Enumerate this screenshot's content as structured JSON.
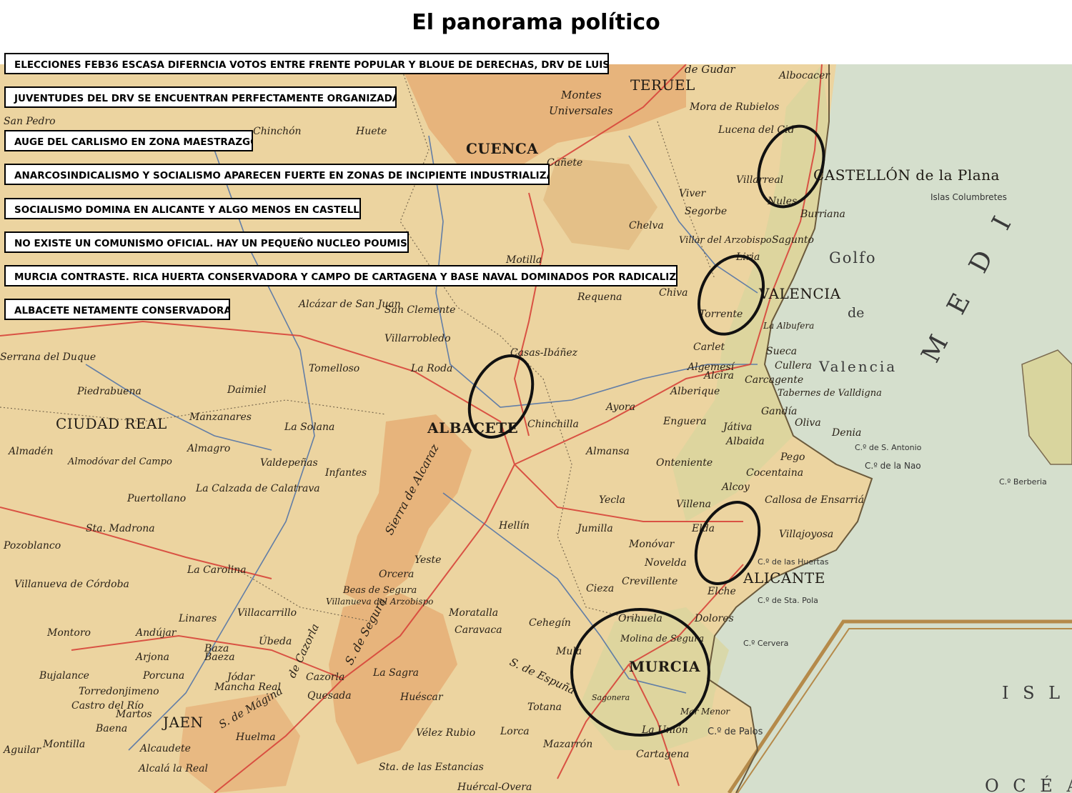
{
  "title": "El panorama político",
  "notes": [
    "ELECCIONES FEB36 ESCASA DIFERNCIA VOTOS  ENTRE FRENTE POPULAR Y BLOUE DE DERECHAS, DRV  DE LUIS LUCIA",
    "JUVENTUDES DEL DRV SE ENCUENTRAN PERFECTAMENTE ORGANIZADAS",
    "AUGE DEL CARLISMO EN ZONA MAESTRAZGO",
    "ANARCOSINDICALISMO Y SOCIALISMO APARECEN FUERTE EN ZONAS DE INCIPIENTE INDUSTRIALIZACION",
    "SOCIALISMO DOMINA EN ALICANTE Y ALGO MENOS EN CASTELLÓN",
    "NO EXISTE UN COMUNISMO OFICIAL. HAY UN PEQUEÑO NUCLEO POUMISTA",
    "MURCIA CONTRASTE. RICA HUERTA CONSERVADORA Y CAMPO DE CARTAGENA Y BASE NAVAL DOMINADOS POR RADICALIZACION",
    "ALBACETE NETAMENTE CONSERVADORA"
  ],
  "map": {
    "cities": {
      "teruel": "TERUEL",
      "cuenca": "CUENCA",
      "castellon": "CASTELLÓN de la Plana",
      "valencia": "VALENCIA",
      "albacete": "ALBACETE",
      "ciudad_real": "CIUDAD REAL",
      "alicante": "ALICANTE",
      "murcia": "MURCIA",
      "jaen": "JAEN"
    },
    "towns": [
      "de Gudar",
      "Albocacer",
      "Montes",
      "Universales",
      "Mora de Rubielos",
      "Lucena del Cid",
      "San Pedro",
      "Chinchón",
      "Huete",
      "Cañete",
      "Villarreal",
      "Nules",
      "Burriana",
      "Viver",
      "Segorbe",
      "Chelva",
      "Villar del Arzobispo",
      "Liria",
      "Sagunto",
      "Motilla",
      "Requena",
      "Chiva",
      "Torrente",
      "La Albufera",
      "Alcázar de San Juan",
      "San Clemente",
      "Villarrobledo",
      "Casas-Ibáñez",
      "La Roda",
      "Tomelloso",
      "Daimiel",
      "Piedrabuena",
      "Manzanares",
      "La Solana",
      "Almagro",
      "Valdepeñas",
      "Infantes",
      "La Calzada de Calatrava",
      "Almodóvar del Campo",
      "Puertollano",
      "Almadén",
      "Chinchilla",
      "Almansa",
      "Ayora",
      "Carlet",
      "Algemesí",
      "Alcira",
      "Alberique",
      "Sueca",
      "Cullera",
      "Carcagente",
      "Tabernes de Valldigna",
      "Gandía",
      "Oliva",
      "Játiva",
      "Albaida",
      "Enguera",
      "Denia",
      "Pego",
      "Cocentaina",
      "Onteniente",
      "Alcoy",
      "Callosa de Ensarriá",
      "Villajoyosa",
      "Yecla",
      "Jumilla",
      "Villena",
      "Elda",
      "Monóvar",
      "Novelda",
      "Crevillente",
      "Elche",
      "Hellín",
      "Cieza",
      "Orihuela",
      "Dolores",
      "Molina de Segura",
      "Sagonera",
      "Mar Menor",
      "La Unión",
      "Cartagena",
      "Mazarrón",
      "Lorca",
      "Totana",
      "Cehegín",
      "Caravaca",
      "Moratalla",
      "Mula",
      "Yeste",
      "Orcera",
      "Beas de Segura",
      "Villanueva del Arzobispo",
      "Villacarrillo",
      "Úbeda",
      "La Carolina",
      "Linares",
      "Andújar",
      "Montoro",
      "Villanueva de Córdoba",
      "Pozoblanco",
      "Sta. Madrona",
      "Arjona",
      "Baeza",
      "Porcuna",
      "Torredonjimeno",
      "Bujalance",
      "Castro del Río",
      "Martos",
      "Baena",
      "Mancha Real",
      "Jódar",
      "Cazorla",
      "Quesada",
      "La Sagra",
      "Huéscar",
      "Vélez Rubio",
      "Huelma",
      "Alcaudete",
      "Alcalá la Real",
      "Montilla",
      "Aguilar",
      "Sta. de las Estancias",
      "Huércal-Overa",
      "Baza",
      "Serrana del Duque"
    ],
    "seas": {
      "golfo": "Golfo",
      "de": "de",
      "valencia_gulf": "Valencia",
      "mediterraneo": "M E D I",
      "islas_columbretes": "Islas Columbretes",
      "isl": "I S L",
      "oceano": "O C É A"
    },
    "capes": [
      "C.º de S. Antonio",
      "C.º de la Nao",
      "C.º de las Huertas",
      "C.º de Sta. Pola",
      "C.º Cervera",
      "C.º de Palos",
      "C.º Berberia"
    ],
    "mountains": [
      "Sierra de Alcaraz",
      "S. de Segura",
      "de Cazorla",
      "S. de Mágina",
      "S. de Espuña"
    ],
    "colors": {
      "land": "#ecd4a0",
      "highland": "#e7b47c",
      "sea": "#d5dfcd",
      "road": "#d7443a",
      "river": "#4a6fa8",
      "border": "#7a6a50"
    }
  }
}
